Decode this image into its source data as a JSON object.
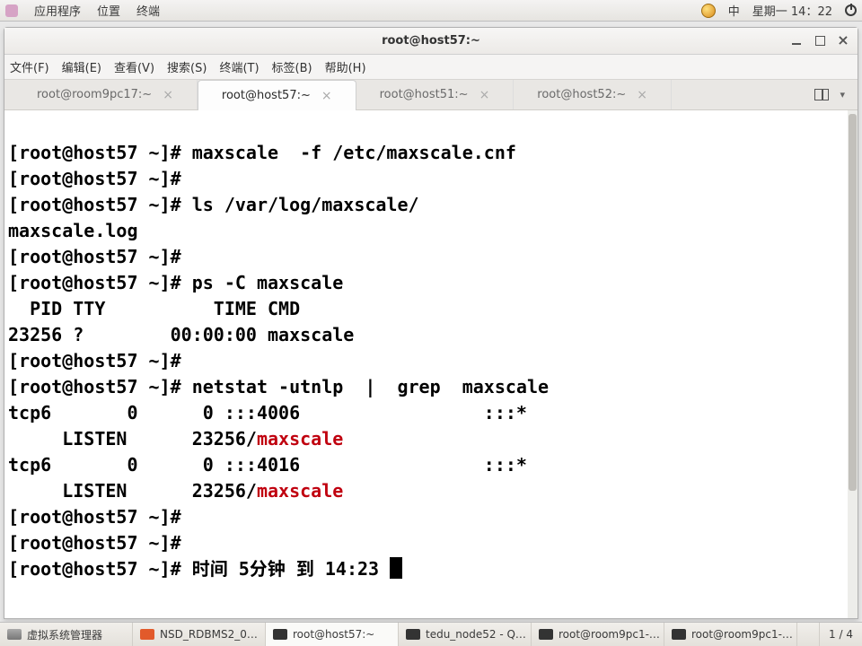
{
  "top_panel": {
    "menu_apps": "应用程序",
    "menu_places": "位置",
    "menu_terminal": "终端",
    "lang": "中",
    "datetime": "星期一 14：22"
  },
  "window": {
    "title": "root@host57:~",
    "menu": {
      "file": "文件(F)",
      "edit": "编辑(E)",
      "view": "查看(V)",
      "search": "搜索(S)",
      "terminal": "终端(T)",
      "tabs": "标签(B)",
      "help": "帮助(H)"
    },
    "tabs": [
      {
        "label": "root@room9pc17:~",
        "active": false
      },
      {
        "label": "root@host57:~",
        "active": true
      },
      {
        "label": "root@host51:~",
        "active": false
      },
      {
        "label": "root@host52:~",
        "active": false
      }
    ]
  },
  "terminal": {
    "lines": [
      {
        "type": "prompt_cmd",
        "prompt": "[root@host57 ~]# ",
        "cmd": "maxscale  -f /etc/maxscale.cnf"
      },
      {
        "type": "prompt_cmd",
        "prompt": "[root@host57 ~]# ",
        "cmd": ""
      },
      {
        "type": "prompt_cmd",
        "prompt": "[root@host57 ~]# ",
        "cmd": "ls /var/log/maxscale/"
      },
      {
        "type": "out",
        "text": "maxscale.log"
      },
      {
        "type": "prompt_cmd",
        "prompt": "[root@host57 ~]# ",
        "cmd": ""
      },
      {
        "type": "prompt_cmd",
        "prompt": "[root@host57 ~]# ",
        "cmd": "ps -C maxscale"
      },
      {
        "type": "out",
        "text": "  PID TTY          TIME CMD"
      },
      {
        "type": "out",
        "text": "23256 ?        00:00:00 maxscale"
      },
      {
        "type": "prompt_cmd",
        "prompt": "[root@host57 ~]# ",
        "cmd": ""
      },
      {
        "type": "prompt_cmd",
        "prompt": "[root@host57 ~]# ",
        "cmd": "netstat -utnlp  |  grep  maxscale"
      },
      {
        "type": "net",
        "a": "tcp6       0      0 :::4006                 :::*"
      },
      {
        "type": "net2",
        "a": "     LISTEN      23256/",
        "hl": "maxscale"
      },
      {
        "type": "net",
        "a": "tcp6       0      0 :::4016                 :::*"
      },
      {
        "type": "net2",
        "a": "     LISTEN      23256/",
        "hl": "maxscale"
      },
      {
        "type": "prompt_cmd",
        "prompt": "[root@host57 ~]# ",
        "cmd": ""
      },
      {
        "type": "prompt_cmd",
        "prompt": "[root@host57 ~]# ",
        "cmd": ""
      },
      {
        "type": "prompt_input",
        "prompt": "[root@host57 ~]# ",
        "cmd": "时间 5分钟 到 14:23 "
      }
    ]
  },
  "taskbar": {
    "items": [
      {
        "icon": "vm",
        "label": "虚拟系统管理器"
      },
      {
        "icon": "pdf",
        "label": "NSD_RDBMS2_0…"
      },
      {
        "icon": "term",
        "label": "root@host57:~",
        "active": true
      },
      {
        "icon": "term",
        "label": "tedu_node52 - Q…"
      },
      {
        "icon": "term",
        "label": "root@room9pc1-…"
      },
      {
        "icon": "term",
        "label": "root@room9pc1-…"
      }
    ],
    "pager": "1 / 4"
  }
}
